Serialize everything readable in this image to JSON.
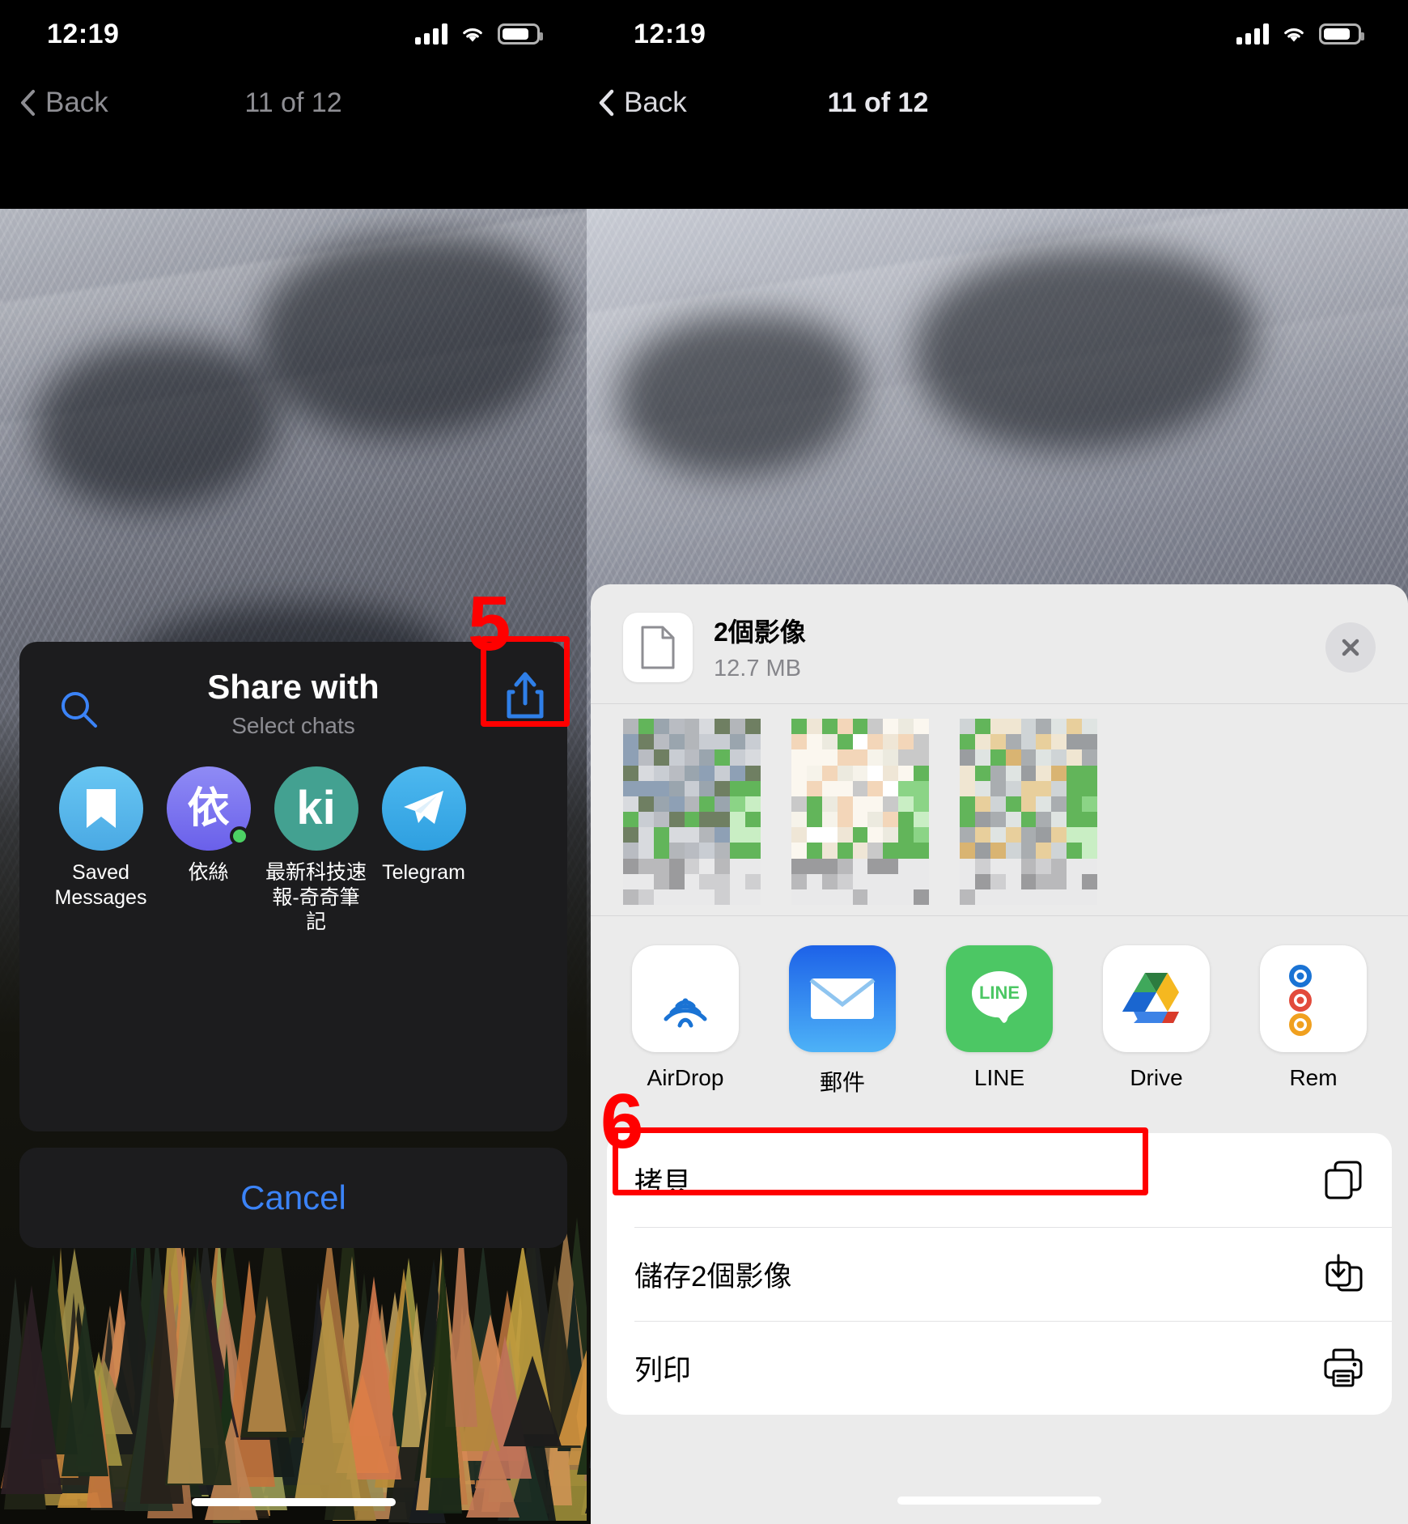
{
  "meta": {
    "accent_blue": "#3b83f7",
    "annotation_red": "#ff0000",
    "telegram_sheet_bg": "#1c1c1e",
    "ios_sheet_bg": "#ebebeb"
  },
  "left_panel": {
    "status": {
      "time": "12:19",
      "cellular": "signal-bars-icon",
      "wifi": "wifi-icon",
      "battery": "battery-icon"
    },
    "nav": {
      "back_label": "Back",
      "title": "11 of 12"
    },
    "share_sheet": {
      "search_icon": "search-icon",
      "title": "Share with",
      "subtitle": "Select chats",
      "share_icon": "share-up-icon",
      "chats": [
        {
          "label": "Saved Messages",
          "avatar_glyph": "bookmark-icon",
          "avatar_color": "#55b7ed",
          "online": false
        },
        {
          "label": "依絲",
          "avatar_glyph": "依",
          "avatar_color": "#7b75f0",
          "online": true
        },
        {
          "label": "最新科技速報-奇奇筆記",
          "avatar_glyph": "ki",
          "avatar_color": "#43a191",
          "online": false
        },
        {
          "label": "Telegram",
          "avatar_glyph": "telegram-plane-icon",
          "avatar_color": "#3aa9e8",
          "online": false
        }
      ],
      "cancel_label": "Cancel"
    },
    "annotation": {
      "number": "5"
    }
  },
  "right_panel": {
    "status": {
      "time": "12:19",
      "cellular": "signal-bars-icon",
      "wifi": "wifi-icon",
      "battery": "battery-icon"
    },
    "nav": {
      "back_label": "Back",
      "title": "11 of 12"
    },
    "share_sheet": {
      "file_icon": "document-icon",
      "file_name": "2個影像",
      "file_size": "12.7 MB",
      "close_icon": "close-icon",
      "thumbnails": [
        "thumbnail-1",
        "thumbnail-2",
        "thumbnail-3"
      ],
      "apps": [
        {
          "label": "AirDrop",
          "icon": "airdrop-icon"
        },
        {
          "label": "郵件",
          "icon": "mail-icon"
        },
        {
          "label": "LINE",
          "icon": "line-icon"
        },
        {
          "label": "Drive",
          "icon": "google-drive-icon"
        },
        {
          "label": "Rem",
          "icon": "reminders-icon"
        }
      ],
      "actions": [
        {
          "label": "拷貝",
          "icon": "copy-icon",
          "highlighted": false
        },
        {
          "label": "儲存2個影像",
          "icon": "save-to-photos-icon",
          "highlighted": true
        },
        {
          "label": "列印",
          "icon": "printer-icon",
          "highlighted": false
        }
      ]
    },
    "annotation": {
      "number": "6"
    }
  }
}
